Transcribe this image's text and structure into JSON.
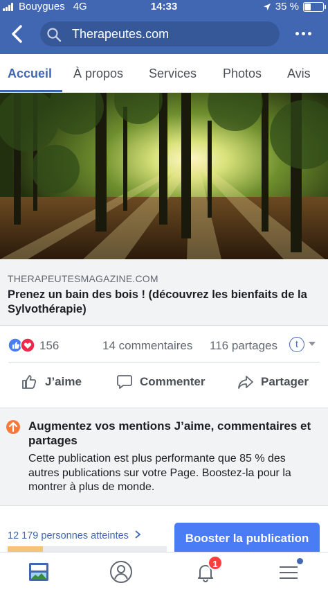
{
  "status": {
    "carrier": "Bouygues",
    "network": "4G",
    "time": "14:33",
    "battery": "35 %"
  },
  "search": {
    "value": "Therapeutes.com"
  },
  "tabs": [
    {
      "label": "Accueil"
    },
    {
      "label": "À propos"
    },
    {
      "label": "Services"
    },
    {
      "label": "Photos"
    },
    {
      "label": "Avis"
    }
  ],
  "link": {
    "domain": "THERAPEUTESMAGAZINE.COM",
    "title": "Prenez un bain des bois ! (découvrez les bienfaits de la Sylvothérapie)"
  },
  "reactions": {
    "count": "156",
    "comments": "14 commentaires",
    "shares": "116 partages",
    "profile_letter": "t"
  },
  "actions": {
    "like": "J’aime",
    "comment": "Commenter",
    "share": "Partager"
  },
  "boost": {
    "title": "Augmentez vos mentions J’aime, commentaires et partages",
    "description": "Cette publication est plus performante que 85 % des autres publications sur votre Page. Boostez-la pour la montrer à plus de monde.",
    "reach_link": "12 179 personnes atteintes",
    "button": "Booster la publication"
  },
  "nav": {
    "notifications_badge": "1"
  },
  "colors": {
    "brand": "#4267b2",
    "boost_button": "#4a7cf5",
    "badge": "#fa3e3e",
    "boost_icon": "#f5793a"
  }
}
